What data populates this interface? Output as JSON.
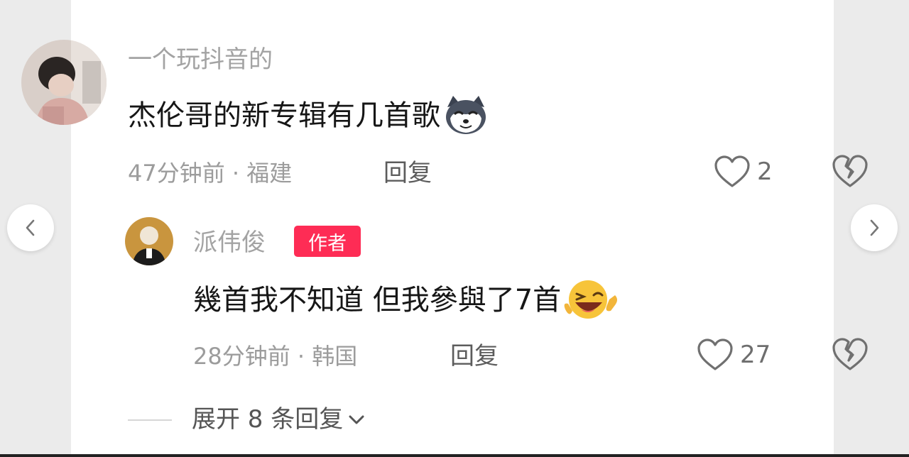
{
  "comment": {
    "username": "一个玩抖音的",
    "text": "杰伦哥的新专辑有几首歌",
    "emoji_icon": "husky-dog-emoji-icon",
    "time_location": "47分钟前 · 福建",
    "reply_label": "回复",
    "like_count": "2"
  },
  "reply": {
    "username": "派伟俊",
    "author_badge": "作者",
    "text": "幾首我不知道 但我參與了7首",
    "emoji_icon": "winking-laughing-face-icon",
    "time_location": "28分钟前 · 韩国",
    "reply_label": "回复",
    "like_count": "27"
  },
  "expand_replies": "展开 8 条回复",
  "colors": {
    "badge": "#fe2c55",
    "page_bg": "#ebebeb",
    "card_bg": "#ffffff"
  }
}
